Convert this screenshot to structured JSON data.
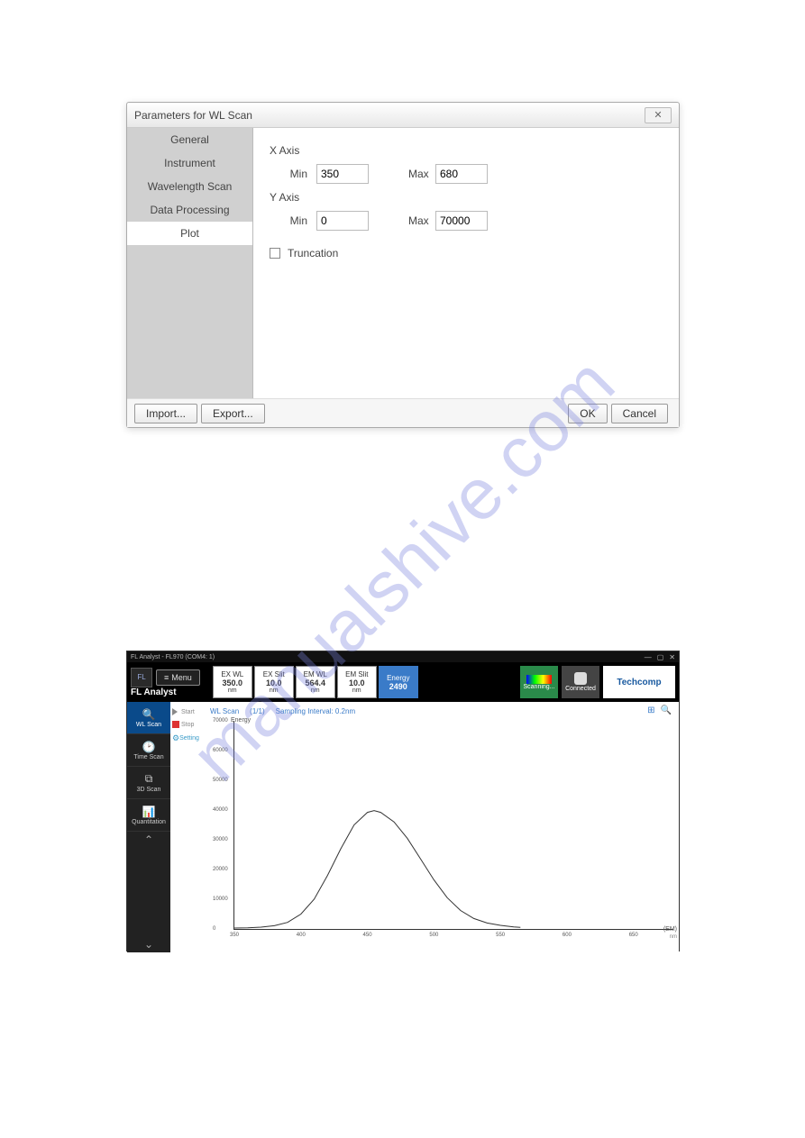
{
  "dialog": {
    "title": "Parameters for WL Scan",
    "tabs": [
      "General",
      "Instrument",
      "Wavelength Scan",
      "Data Processing",
      "Plot"
    ],
    "active_tab": "Plot",
    "xaxis_label": "X Axis",
    "yaxis_label": "Y Axis",
    "min_label": "Min",
    "max_label": "Max",
    "x_min": "350",
    "x_max": "680",
    "y_min": "0",
    "y_max": "70000",
    "truncation_label": "Truncation",
    "truncation_checked": false,
    "import_btn": "Import...",
    "export_btn": "Export...",
    "ok_btn": "OK",
    "cancel_btn": "Cancel"
  },
  "app": {
    "title": "FL Analyst - FL970 (COM4: 1)",
    "brand": "FL Analyst",
    "menu_label": "Menu",
    "params": [
      {
        "title": "EX WL",
        "value": "350.0",
        "unit": "nm"
      },
      {
        "title": "EX Slit",
        "value": "10.0",
        "unit": "nm"
      },
      {
        "title": "EM WL",
        "value": "564.4",
        "unit": "nm"
      },
      {
        "title": "EM Slit",
        "value": "10.0",
        "unit": "nm"
      },
      {
        "title": "Energy",
        "value": "2490",
        "unit": ""
      }
    ],
    "scanning_label": "Scanning...",
    "connected_label": "Connected",
    "company": "Techcomp",
    "modes": [
      "WL Scan",
      "Time Scan",
      "3D Scan",
      "Quantitation"
    ],
    "active_mode": "WL Scan",
    "start_label": "Start",
    "stop_label": "Stop",
    "setting_label": "Setting",
    "chart_title": "WL Scan",
    "chart_count": "(1/1)",
    "sampling": "Sampling Interval: 0.2nm"
  },
  "chart_data": {
    "type": "line",
    "title": "WL Scan",
    "xlabel": "(EM)",
    "xunit": "nm",
    "ylabel": "Energy",
    "xlim": [
      350,
      680
    ],
    "ylim": [
      0,
      70000
    ],
    "x_ticks": [
      350,
      400,
      450,
      500,
      550,
      600,
      650
    ],
    "y_ticks": [
      0,
      10000,
      20000,
      30000,
      40000,
      50000,
      60000,
      70000
    ],
    "x": [
      350,
      360,
      370,
      380,
      390,
      400,
      410,
      420,
      430,
      440,
      450,
      455,
      460,
      470,
      480,
      490,
      500,
      510,
      520,
      530,
      540,
      550,
      560,
      565
    ],
    "values": [
      300,
      400,
      600,
      1100,
      2200,
      5000,
      10000,
      18000,
      27000,
      35000,
      39200,
      39800,
      39200,
      36000,
      30500,
      23500,
      16500,
      10500,
      6200,
      3500,
      2000,
      1200,
      700,
      500
    ]
  }
}
